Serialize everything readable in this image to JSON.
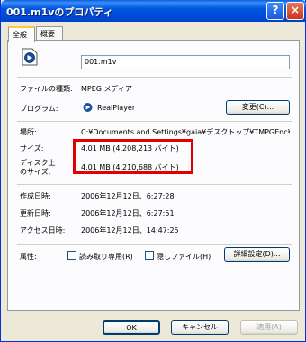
{
  "window": {
    "title": "001.m1vのプロパティ",
    "help_label": "?",
    "close_label": "×"
  },
  "tabs": [
    {
      "label": "全般"
    },
    {
      "label": "概要"
    }
  ],
  "general": {
    "filename": "001.m1v",
    "file_type_label": "ファイルの種類:",
    "file_type_value": "MPEG メディア",
    "program_label": "プログラム:",
    "program_value": "RealPlayer",
    "change_button": "変更(C)...",
    "location_label": "場所:",
    "location_value": "C:¥Documents and Settings¥gaia¥デスクトップ¥TMPGEnc¥",
    "size_label": "サイズ:",
    "size_value": "4.01 MB (4,208,213 バイト)",
    "disk_size_label_1": "ディスク上",
    "disk_size_label_2": "のサイズ:",
    "disk_size_value": "4.01 MB (4,210,688 バイト)",
    "created_label": "作成日時:",
    "created_value": "2006年12月12日、6:27:28",
    "modified_label": "更新日時:",
    "modified_value": "2006年12月12日、6:27:51",
    "accessed_label": "アクセス日時:",
    "accessed_value": "2006年12月12日、14:47:25",
    "attributes_label": "属性:",
    "readonly_label": "読み取り専用(R)",
    "hidden_label": "隠しファイル(H)",
    "advanced_button": "詳細設定(D)..."
  },
  "footer": {
    "ok": "OK",
    "cancel": "キャンセル",
    "apply": "適用(A)"
  },
  "colors": {
    "highlight_border": "#E00000",
    "titlebar": "#0054E3"
  },
  "icons": {
    "file": "realplayer-file-icon",
    "program": "realplayer-icon"
  }
}
